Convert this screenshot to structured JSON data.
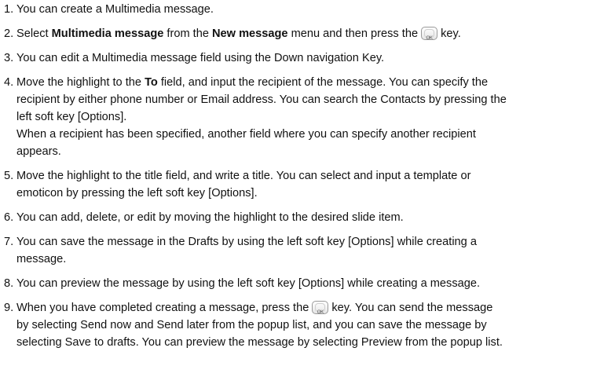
{
  "steps": [
    {
      "num": "1.",
      "lines": [
        "You can create a Multimedia message."
      ]
    },
    {
      "num": "2.",
      "parts": {
        "a": "Select ",
        "b": "Multimedia message",
        "c": " from the ",
        "d": "New message",
        "e": " menu and then press the",
        "f": "key."
      }
    },
    {
      "num": "3.",
      "lines": [
        "You can edit a Multimedia message field using the Down navigation Key."
      ]
    },
    {
      "num": "4.",
      "parts": {
        "a": "Move the highlight to the ",
        "b": "To",
        "c": " field, and input the recipient of the message. You can specify the"
      },
      "lines": [
        "recipient by either phone number or Email address. You can search the Contacts by pressing the",
        "left soft key [Options].",
        "When a recipient has been specified, another field where you can specify another recipient",
        "appears."
      ]
    },
    {
      "num": "5.",
      "lines": [
        "Move the highlight to the title field, and write a title. You can select and input a template or",
        "emoticon by pressing the left soft key [Options]."
      ]
    },
    {
      "num": "6.",
      "lines": [
        "You can add, delete, or edit by moving the highlight to the desired slide item."
      ]
    },
    {
      "num": "7.",
      "lines": [
        "You can save the message in the Drafts by using the left soft key [Options] while creating a",
        "message."
      ]
    },
    {
      "num": "8.",
      "lines": [
        "You can preview the message by using the left soft key [Options] while creating a message."
      ]
    },
    {
      "num": "9.",
      "parts": {
        "a": "When you have completed creating a message, press the",
        "b": "key. You can send the message"
      },
      "lines": [
        "by selecting Send now and Send later from the popup list, and you can save the message by",
        "selecting Save to drafts. You can preview the message by selecting Preview from the popup list."
      ]
    }
  ],
  "ok_key_label": "OK",
  "ok_key_icon": "ok-key-icon"
}
